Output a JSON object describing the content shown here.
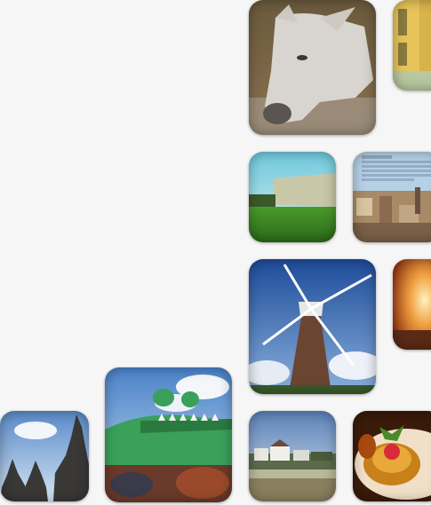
{
  "gallery": {
    "photos": [
      {
        "name": "donkey-photo"
      },
      {
        "name": "train-photo"
      },
      {
        "name": "building-lawn-photo"
      },
      {
        "name": "city-skyline-photo"
      },
      {
        "name": "windmill-photo"
      },
      {
        "name": "sunset-photo"
      },
      {
        "name": "crocodile-inflatable-photo"
      },
      {
        "name": "temple-stupas-photo"
      },
      {
        "name": "seaside-houses-photo"
      },
      {
        "name": "dessert-photo"
      }
    ]
  }
}
